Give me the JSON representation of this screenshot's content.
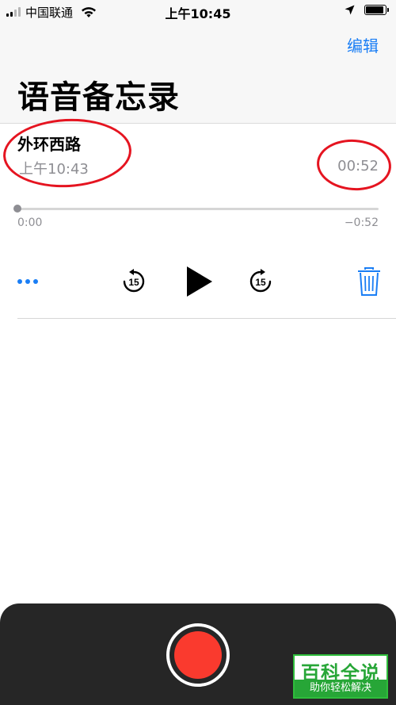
{
  "status_bar": {
    "carrier": "中国联通",
    "time": "上午10:45",
    "signal_bars_active": 2,
    "signal_bars_total": 4,
    "battery_level": 0.9
  },
  "header": {
    "edit_label": "编辑",
    "title": "语音备忘录"
  },
  "recording": {
    "title": "外环西路",
    "time": "上午10:43",
    "duration": "00:52",
    "elapsed": "0:00",
    "remaining": "−0:52",
    "progress": 0.0
  },
  "controls": {
    "skip_back_seconds": "15",
    "skip_forward_seconds": "15",
    "icons": [
      "more-icon",
      "skip-back-icon",
      "play-icon",
      "skip-forward-icon",
      "trash-icon",
      "record-icon"
    ]
  },
  "watermark": {
    "main": "百科全说",
    "sub": "助你轻松解决"
  },
  "colors": {
    "accent": "#1a7ef5",
    "record": "#fa3a2e",
    "panel": "#262626",
    "secondary_text": "#8e8e93",
    "annotation": "#e51420",
    "watermark_green": "#27a637"
  }
}
